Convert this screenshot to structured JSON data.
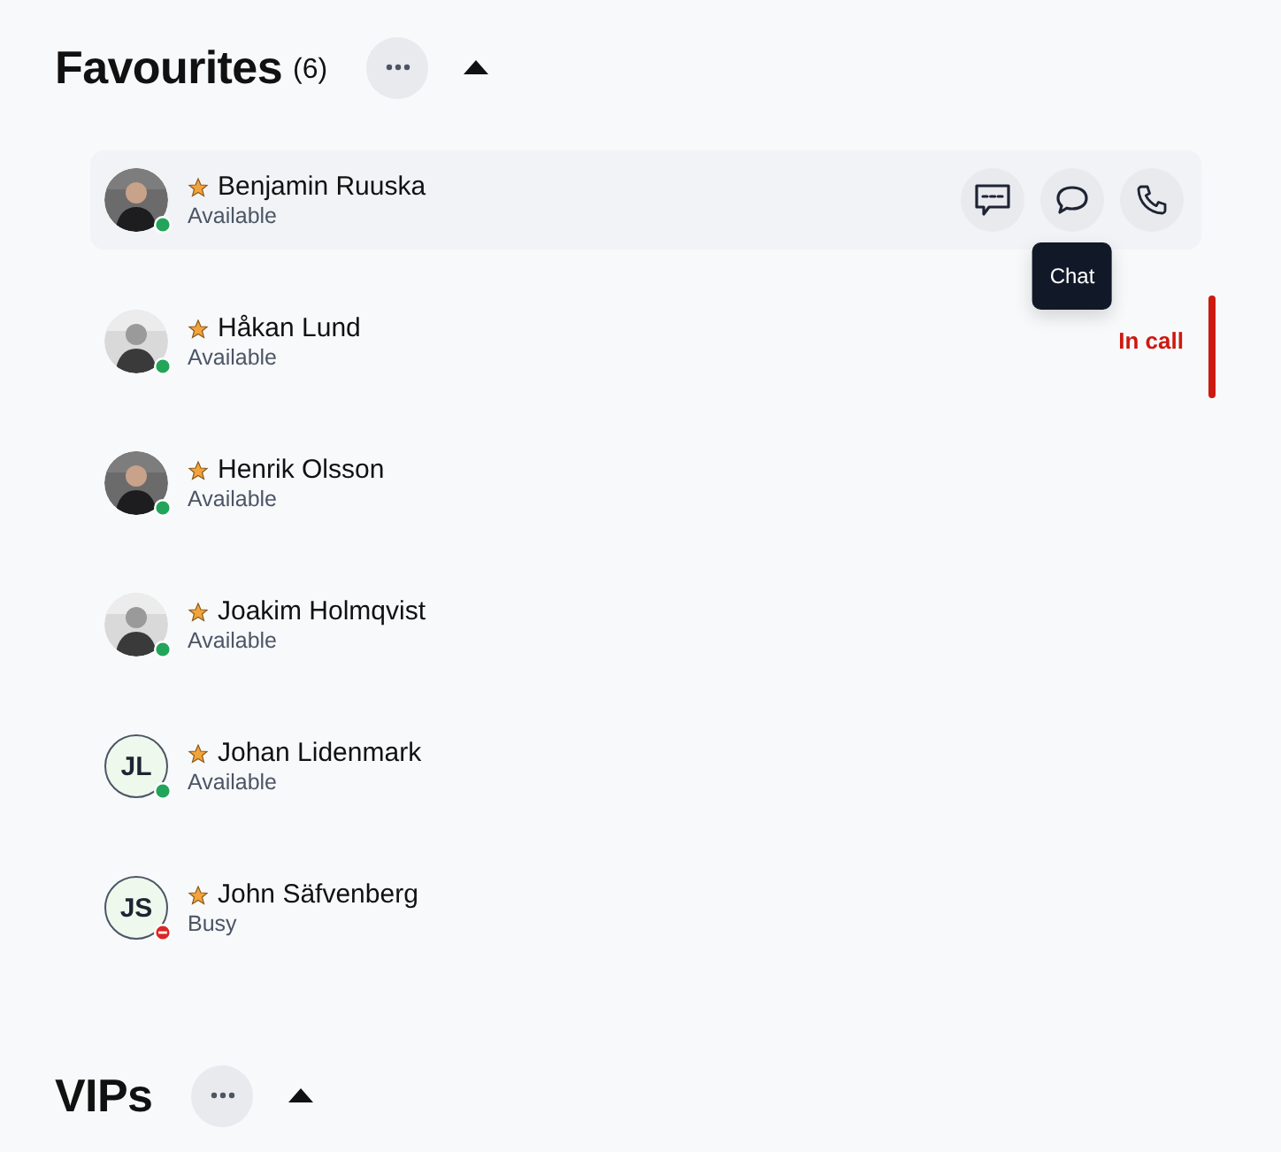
{
  "sections": [
    {
      "title": "Favourites",
      "count": "(6)",
      "expanded": true,
      "contacts": [
        {
          "name": "Benjamin Ruuska",
          "status": "Available",
          "kind": "available",
          "color": "#22a55a",
          "favourite": true,
          "hovered": true,
          "actions": [
            {
              "kind": "sms"
            },
            {
              "kind": "chat",
              "tooltip": "Chat"
            },
            {
              "kind": "call"
            }
          ]
        },
        {
          "name": "Håkan Lund",
          "status": "Available",
          "kind": "available",
          "color": "#22a55a",
          "favourite": true,
          "hovered": false,
          "call_status": "In call"
        },
        {
          "name": "Henrik Olsson",
          "status": "Available",
          "kind": "available",
          "color": "#22a55a",
          "favourite": true,
          "hovered": false
        },
        {
          "name": "Joakim Holmqvist",
          "status": "Available",
          "kind": "available",
          "color": "#22a55a",
          "favourite": true,
          "hovered": false
        },
        {
          "name": "Johan Lidenmark",
          "status": "Available",
          "kind": "available",
          "color": "#22a55a",
          "favourite": true,
          "avatar": {
            "kind": "initials",
            "initials": "JL"
          },
          "hovered": false
        },
        {
          "name": "John Säfvenberg",
          "status": "Busy",
          "kind": "busy",
          "color": "#dc2626",
          "favourite": true,
          "avatar": {
            "kind": "initials",
            "initials": "JS"
          },
          "hovered": false
        }
      ]
    },
    {
      "title": "VIPs",
      "expanded": true
    }
  ]
}
